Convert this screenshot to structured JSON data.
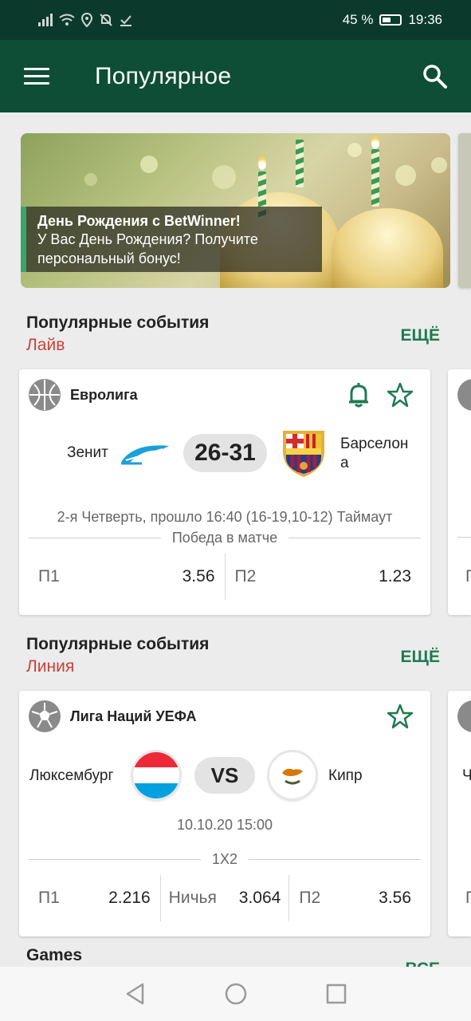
{
  "status_bar": {
    "battery": "45 %",
    "time": "19:36"
  },
  "app_bar": {
    "title": "Популярное"
  },
  "banner": {
    "title": "День Рождения с BetWinner!",
    "text_line1": "У Вас День Рождения? Получите",
    "text_line2": "персональный бонус!"
  },
  "live_section": {
    "title": "Популярные события",
    "subtitle": "Лайв",
    "more": "ЕЩЁ"
  },
  "live_card": {
    "league": "Евролига",
    "home_team": "Зенит",
    "away_team_line1": "Барселон",
    "away_team_line2": "а",
    "score": "26-31",
    "status": "2-я Четверть, прошло 16:40 (16-19,10-12) Таймаут",
    "market": "Победа в матче",
    "odds": [
      {
        "label": "П1",
        "value": "3.56"
      },
      {
        "label": "П2",
        "value": "1.23"
      }
    ]
  },
  "line_section": {
    "title": "Популярные события",
    "subtitle": "Линия",
    "more": "ЕЩЁ"
  },
  "line_card": {
    "league": "Лига Наций УЕФА",
    "home_team": "Люксембург",
    "away_team": "Кипр",
    "vs": "VS",
    "datetime": "10.10.20 15:00",
    "market": "1X2",
    "odds": [
      {
        "label": "П1",
        "value": "2.216"
      },
      {
        "label": "Ничья",
        "value": "3.064"
      },
      {
        "label": "П2",
        "value": "3.56"
      }
    ]
  },
  "peek_card2": {
    "odd_label": "П",
    "team_partial": "Ч"
  },
  "games_section": {
    "title": "Games",
    "more": "ВСЕ"
  },
  "colors": {
    "brand_dark": "#0e4d36",
    "accent_green": "#1f7a52",
    "live_red": "#c9413b"
  }
}
